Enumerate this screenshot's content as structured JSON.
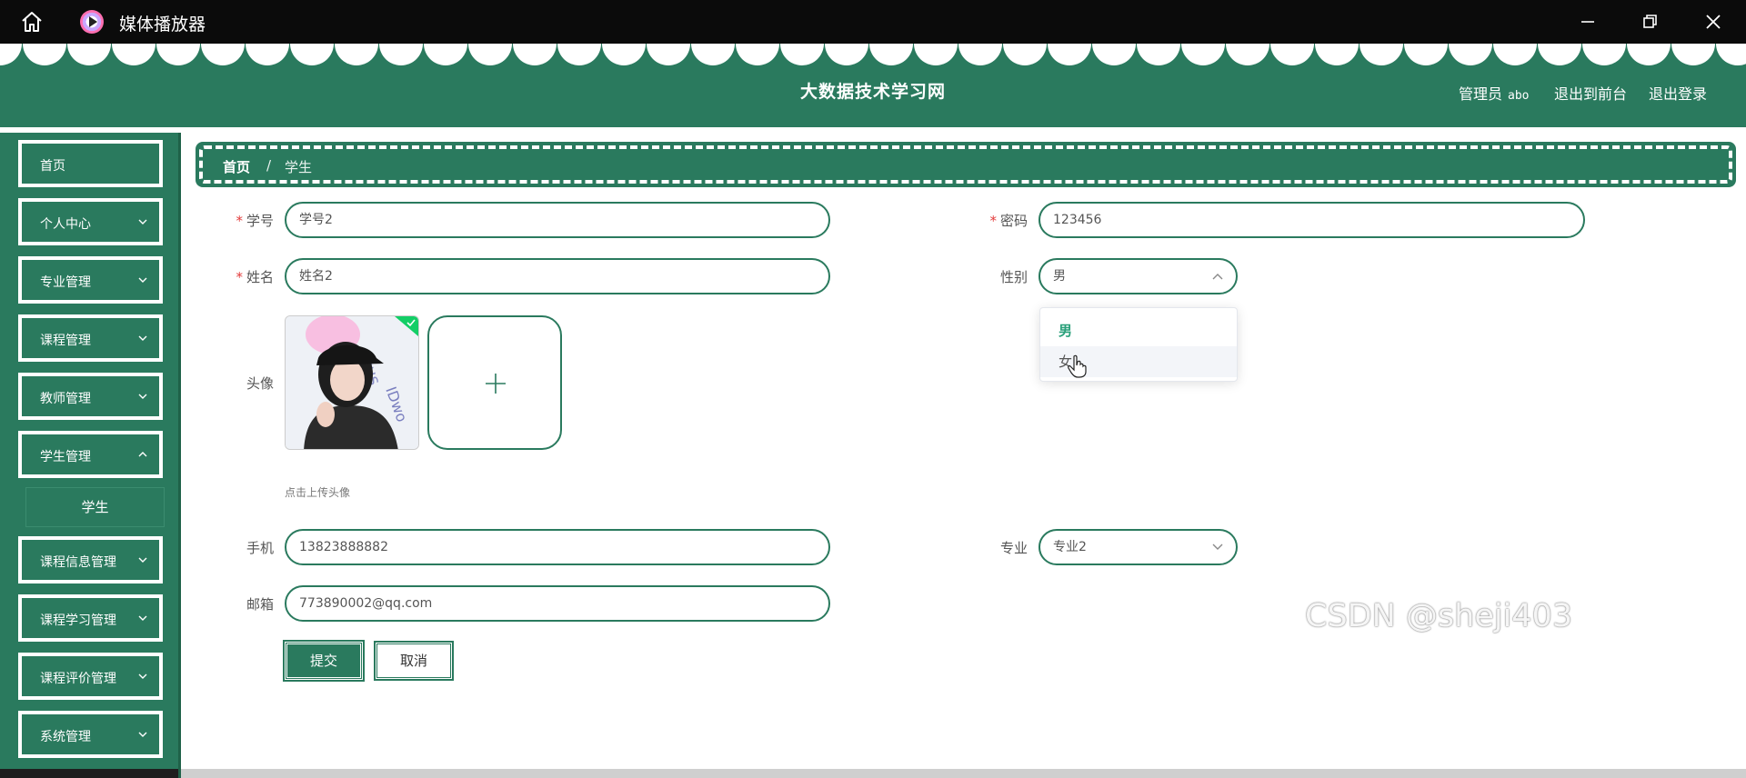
{
  "window": {
    "app_title": "媒体播放器"
  },
  "header": {
    "site_title": "大数据技术学习网",
    "admin_label": "管理员",
    "admin_name": "abo",
    "to_front_label": "退出到前台",
    "logout_label": "退出登录"
  },
  "sidebar": {
    "items": [
      {
        "label": "首页"
      },
      {
        "label": "个人中心"
      },
      {
        "label": "专业管理"
      },
      {
        "label": "课程管理"
      },
      {
        "label": "教师管理"
      },
      {
        "label": "学生管理"
      },
      {
        "label": "课程信息管理"
      },
      {
        "label": "课程学习管理"
      },
      {
        "label": "课程评价管理"
      },
      {
        "label": "系统管理"
      }
    ],
    "subitem": {
      "label": "学生"
    }
  },
  "breadcrumb": {
    "home": "首页",
    "separator": "/",
    "current": "学生"
  },
  "form": {
    "student_id": {
      "label": "学号",
      "value": "学号2"
    },
    "password": {
      "label": "密码",
      "value": "123456"
    },
    "name": {
      "label": "姓名",
      "value": "姓名2"
    },
    "gender": {
      "label": "性别",
      "value": "男",
      "options": [
        "男",
        "女"
      ]
    },
    "avatar": {
      "label": "头像",
      "hint": "点击上传头像"
    },
    "phone": {
      "label": "手机",
      "value": "13823888882"
    },
    "major": {
      "label": "专业",
      "value": "专业2"
    },
    "email": {
      "label": "邮箱",
      "value": "773890002@qq.com"
    },
    "submit_label": "提交",
    "cancel_label": "取消"
  },
  "watermark": "CSDN @sheji403",
  "colors": {
    "primary": "#2a7a5e",
    "required": "#e23b3b",
    "option_selected": "#2aa07a"
  }
}
